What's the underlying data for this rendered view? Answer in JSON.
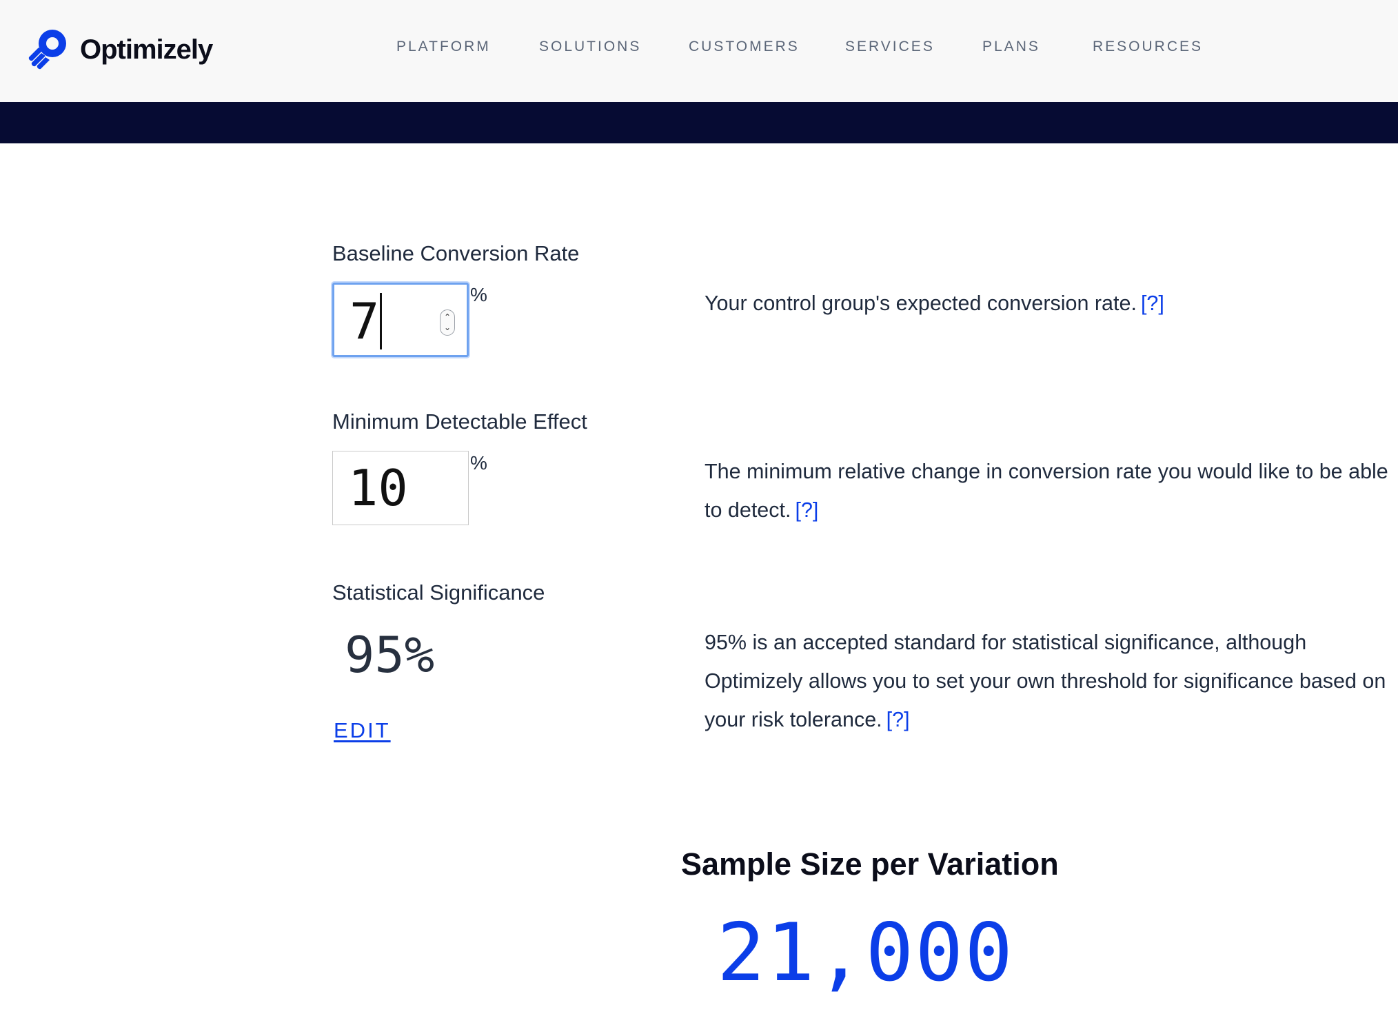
{
  "brand": {
    "name": "Optimizely",
    "accent": "#0b3ee8",
    "band": "#060b33"
  },
  "nav": {
    "items": [
      "PLATFORM",
      "SOLUTIONS",
      "CUSTOMERS",
      "SERVICES",
      "PLANS",
      "RESOURCES"
    ]
  },
  "form": {
    "baseline": {
      "label": "Baseline Conversion Rate",
      "value": "7",
      "unit": "%",
      "description": "Your control group's expected conversion rate.",
      "help": "[?]"
    },
    "mde": {
      "label": "Minimum Detectable Effect",
      "value": "10",
      "unit": "%",
      "description": "The minimum relative change in conversion rate you would like to be able to detect.",
      "help": "[?]"
    },
    "significance": {
      "label": "Statistical Significance",
      "value": "95%",
      "edit_label": "EDIT",
      "description": "95% is an accepted standard for statistical significance, although Optimizely allows you to set your own threshold for significance based on your risk tolerance.",
      "help": "[?]"
    }
  },
  "result": {
    "title": "Sample Size per Variation",
    "value": "21,000"
  }
}
